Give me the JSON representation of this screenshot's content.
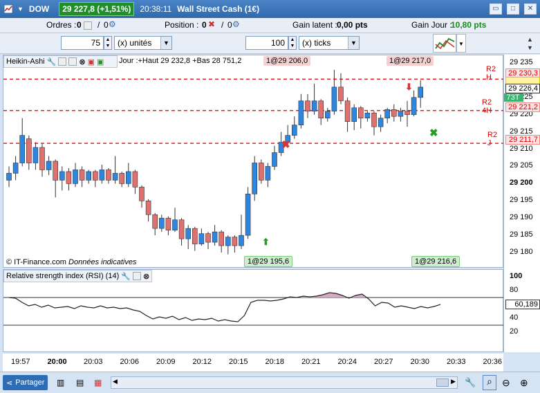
{
  "titlebar": {
    "symbol": "DOW",
    "price_badge": "29 227,8 (+1,51%)",
    "time": "20:38:11",
    "instrument": "Wall Street Cash (1€)"
  },
  "toolbar": {
    "orders_label": "Ordres :",
    "orders_value": "0",
    "orders_value2": "0",
    "position_label": "Position :",
    "position_value": "0",
    "position_value2": "0",
    "gain_latent_label": "Gain latent :",
    "gain_latent_value": "0,00 pts",
    "gain_jour_label": "Gain Jour :",
    "gain_jour_value": "10,80 pts",
    "qty_value": "75",
    "qty_unit": "(x) unités",
    "ticks_value": "100",
    "ticks_unit": "(x) ticks"
  },
  "chart_header": {
    "indicator": "Heikin-Ashi",
    "day_info": "Jour :+Haut 29 232,8 +Bas 28 751,2",
    "tag_top_left": "1@29 206,0",
    "tag_top_right": "1@29 217,0",
    "tag_bottom_left": "1@29 195,6",
    "tag_bottom_right": "1@29 216,6",
    "credit": "© IT-Finance.com",
    "credit_note": "Données indicatives"
  },
  "levels": {
    "r2h": "R2 H",
    "r2_4h": "R2 4H",
    "r2j": "R2 J",
    "r2h_price": "29 230,3",
    "r2_4h_price": "29 221,2",
    "r2j_price": "29 211,7",
    "current_price": "29 226,4",
    "current_label": "73T"
  },
  "price_axis": [
    "29 235",
    "29 230",
    "29 225",
    "29 220",
    "29 215",
    "29 210",
    "29 205",
    "29 200",
    "29 195",
    "29 190",
    "29 185",
    "29 180"
  ],
  "rsi": {
    "title": "Relative strength index (RSI) (14)",
    "value": "60,189",
    "axis": [
      "100",
      "80",
      "60",
      "40",
      "20"
    ]
  },
  "time_axis": [
    "19:57",
    "20:00",
    "20:03",
    "20:06",
    "20:09",
    "20:12",
    "20:15",
    "20:18",
    "20:21",
    "20:24",
    "20:27",
    "20:30",
    "20:33",
    "20:36"
  ],
  "footer": {
    "share": "Partager"
  },
  "chart_data": {
    "type": "candlestick",
    "title": "",
    "xlabel": "",
    "ylabel": "",
    "ylim": [
      29177,
      29236
    ],
    "reference_lines": [
      {
        "name": "R2 H",
        "value": 29230.3
      },
      {
        "name": "R2 4H",
        "value": 29221.2
      },
      {
        "name": "R2 J",
        "value": 29211.7
      }
    ],
    "candles": [
      {
        "o": 29201.0,
        "c": 29203.0,
        "h": 29205.0,
        "l": 29199.0
      },
      {
        "o": 29203.0,
        "c": 29206.0,
        "h": 29208.0,
        "l": 29201.0
      },
      {
        "o": 29206.0,
        "c": 29214.0,
        "h": 29219.0,
        "l": 29205.0
      },
      {
        "o": 29213.0,
        "c": 29206.0,
        "h": 29214.0,
        "l": 29204.0
      },
      {
        "o": 29206.0,
        "c": 29210.5,
        "h": 29212.0,
        "l": 29204.0
      },
      {
        "o": 29210.5,
        "c": 29204.0,
        "h": 29211.5,
        "l": 29202.0
      },
      {
        "o": 29204.0,
        "c": 29206.5,
        "h": 29208.0,
        "l": 29202.5
      },
      {
        "o": 29206.5,
        "c": 29201.0,
        "h": 29207.0,
        "l": 29196.0
      },
      {
        "o": 29201.0,
        "c": 29203.5,
        "h": 29205.0,
        "l": 29198.0
      },
      {
        "o": 29203.5,
        "c": 29200.0,
        "h": 29204.5,
        "l": 29198.0
      },
      {
        "o": 29200.0,
        "c": 29204.0,
        "h": 29206.0,
        "l": 29199.0
      },
      {
        "o": 29204.0,
        "c": 29201.0,
        "h": 29205.0,
        "l": 29199.0
      },
      {
        "o": 29201.0,
        "c": 29203.5,
        "h": 29204.0,
        "l": 29200.0
      },
      {
        "o": 29203.5,
        "c": 29201.0,
        "h": 29204.0,
        "l": 29199.0
      },
      {
        "o": 29201.0,
        "c": 29204.0,
        "h": 29205.5,
        "l": 29200.0
      },
      {
        "o": 29204.0,
        "c": 29201.0,
        "h": 29204.5,
        "l": 29200.0
      },
      {
        "o": 29201.0,
        "c": 29203.0,
        "h": 29208.0,
        "l": 29200.0
      },
      {
        "o": 29203.0,
        "c": 29200.0,
        "h": 29203.5,
        "l": 29199.0
      },
      {
        "o": 29200.0,
        "c": 29203.5,
        "h": 29206.0,
        "l": 29199.0
      },
      {
        "o": 29203.5,
        "c": 29199.0,
        "h": 29204.0,
        "l": 29197.0
      },
      {
        "o": 29199.0,
        "c": 29195.0,
        "h": 29199.5,
        "l": 29193.0
      },
      {
        "o": 29195.0,
        "c": 29191.0,
        "h": 29195.5,
        "l": 29189.0
      },
      {
        "o": 29191.0,
        "c": 29187.0,
        "h": 29191.5,
        "l": 29185.0
      },
      {
        "o": 29187.0,
        "c": 29190.0,
        "h": 29191.0,
        "l": 29186.0
      },
      {
        "o": 29190.0,
        "c": 29186.5,
        "h": 29190.5,
        "l": 29185.0
      },
      {
        "o": 29186.5,
        "c": 29189.5,
        "h": 29193.0,
        "l": 29186.0
      },
      {
        "o": 29189.5,
        "c": 29184.0,
        "h": 29190.0,
        "l": 29182.0
      },
      {
        "o": 29184.0,
        "c": 29187.0,
        "h": 29188.0,
        "l": 29181.0
      },
      {
        "o": 29187.0,
        "c": 29182.5,
        "h": 29187.5,
        "l": 29180.5
      },
      {
        "o": 29182.5,
        "c": 29185.5,
        "h": 29187.0,
        "l": 29182.0
      },
      {
        "o": 29185.5,
        "c": 29183.0,
        "h": 29186.0,
        "l": 29181.0
      },
      {
        "o": 29183.0,
        "c": 29186.0,
        "h": 29188.0,
        "l": 29182.0
      },
      {
        "o": 29186.0,
        "c": 29182.0,
        "h": 29186.5,
        "l": 29180.0
      },
      {
        "o": 29182.0,
        "c": 29184.5,
        "h": 29185.0,
        "l": 29179.5
      },
      {
        "o": 29184.5,
        "c": 29182.0,
        "h": 29185.0,
        "l": 29180.0
      },
      {
        "o": 29182.0,
        "c": 29185.0,
        "h": 29191.0,
        "l": 29181.0
      },
      {
        "o": 29185.0,
        "c": 29197.0,
        "h": 29199.0,
        "l": 29184.0
      },
      {
        "o": 29197.0,
        "c": 29206.0,
        "h": 29208.0,
        "l": 29195.0
      },
      {
        "o": 29206.0,
        "c": 29201.0,
        "h": 29207.0,
        "l": 29200.0
      },
      {
        "o": 29201.0,
        "c": 29205.0,
        "h": 29206.0,
        "l": 29199.0
      },
      {
        "o": 29205.0,
        "c": 29209.0,
        "h": 29211.0,
        "l": 29204.0
      },
      {
        "o": 29209.0,
        "c": 29212.0,
        "h": 29215.0,
        "l": 29208.0
      },
      {
        "o": 29212.0,
        "c": 29214.0,
        "h": 29217.0,
        "l": 29210.5
      },
      {
        "o": 29214.0,
        "c": 29217.0,
        "h": 29219.5,
        "l": 29213.0
      },
      {
        "o": 29217.0,
        "c": 29224.0,
        "h": 29226.0,
        "l": 29216.0
      },
      {
        "o": 29224.0,
        "c": 29221.0,
        "h": 29226.0,
        "l": 29219.0
      },
      {
        "o": 29221.0,
        "c": 29224.0,
        "h": 29229.0,
        "l": 29220.0
      },
      {
        "o": 29224.0,
        "c": 29219.0,
        "h": 29224.5,
        "l": 29217.0
      },
      {
        "o": 29219.0,
        "c": 29221.0,
        "h": 29222.0,
        "l": 29218.0
      },
      {
        "o": 29221.0,
        "c": 29228.0,
        "h": 29233.0,
        "l": 29220.0
      },
      {
        "o": 29228.0,
        "c": 29224.0,
        "h": 29232.0,
        "l": 29223.0
      },
      {
        "o": 29224.0,
        "c": 29218.0,
        "h": 29225.0,
        "l": 29215.0
      },
      {
        "o": 29218.0,
        "c": 29222.0,
        "h": 29223.0,
        "l": 29215.5
      },
      {
        "o": 29222.0,
        "c": 29219.0,
        "h": 29222.5,
        "l": 29216.0
      },
      {
        "o": 29219.0,
        "c": 29220.5,
        "h": 29221.0,
        "l": 29218.0
      },
      {
        "o": 29220.5,
        "c": 29216.5,
        "h": 29221.0,
        "l": 29214.0
      },
      {
        "o": 29216.5,
        "c": 29219.0,
        "h": 29220.0,
        "l": 29215.0
      },
      {
        "o": 29219.0,
        "c": 29221.5,
        "h": 29222.0,
        "l": 29217.5
      },
      {
        "o": 29221.5,
        "c": 29219.5,
        "h": 29223.0,
        "l": 29218.0
      },
      {
        "o": 29219.5,
        "c": 29221.0,
        "h": 29222.0,
        "l": 29218.0
      },
      {
        "o": 29221.0,
        "c": 29220.0,
        "h": 29224.0,
        "l": 29216.5
      },
      {
        "o": 29220.0,
        "c": 29225.0,
        "h": 29227.0,
        "l": 29219.5
      },
      {
        "o": 29225.0,
        "c": 29228.0,
        "h": 29230.0,
        "l": 29222.0
      }
    ],
    "rsi_values": [
      70,
      69,
      63,
      58,
      60,
      56,
      59,
      55,
      56,
      57,
      54,
      58,
      56,
      55,
      58,
      55,
      56,
      54,
      55,
      52,
      50,
      44,
      39,
      42,
      40,
      43,
      38,
      41,
      37,
      39,
      38,
      40,
      36,
      38,
      36,
      35,
      44,
      63,
      66,
      66,
      65,
      66,
      68,
      71,
      70,
      72,
      71,
      72,
      74,
      77,
      76,
      73,
      69,
      73,
      75,
      68,
      58,
      63,
      62,
      56,
      58,
      56,
      54,
      57,
      55,
      57,
      60
    ]
  }
}
